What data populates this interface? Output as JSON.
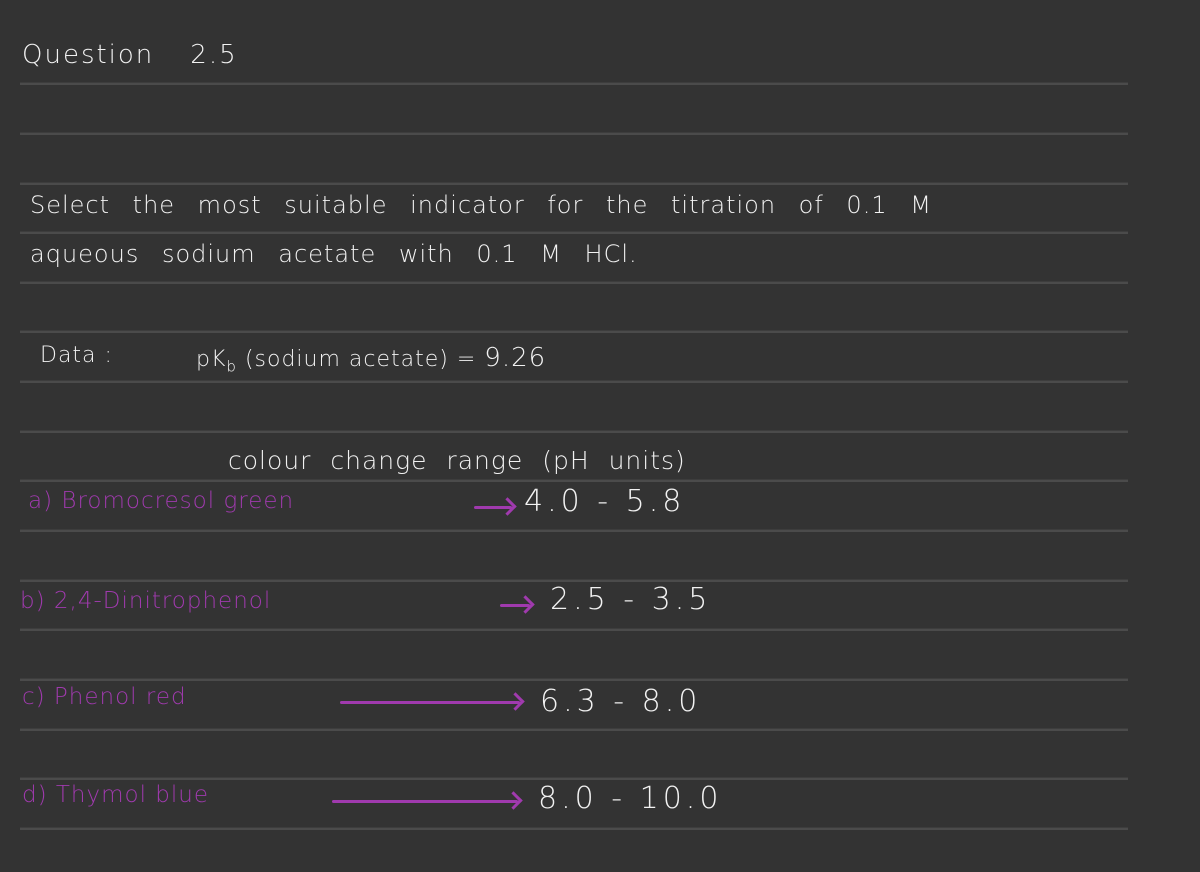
{
  "page": {
    "background_color": "#333333",
    "ink_color": "#f2f2f2",
    "accent_ink_color": "#a03aae",
    "rule_color": "#4b4b4b"
  },
  "title": {
    "label": "Question",
    "number": "2.5"
  },
  "question": {
    "line1": "Select the most suitable indicator for the titration of 0.1 M",
    "line2": "aqueous sodium acetate with 0.1 M HCl."
  },
  "data": {
    "label": "Data :",
    "pkb_symbol": "pK",
    "pkb_subscript": "b",
    "pkb_subject": "(sodium acetate) =",
    "pkb_value": "9.26"
  },
  "indicators": {
    "column_header": "colour change range (pH units)",
    "items": [
      {
        "label": "a) Bromocresol green",
        "range": "4.0 - 5.8"
      },
      {
        "label": "b) 2,4-Dinitrophenol",
        "range": "2.5 - 3.5"
      },
      {
        "label": "c) Phenol red",
        "range": "6.3 - 8.0"
      },
      {
        "label": "d) Thymol blue",
        "range": "8.0 - 10.0"
      }
    ]
  }
}
